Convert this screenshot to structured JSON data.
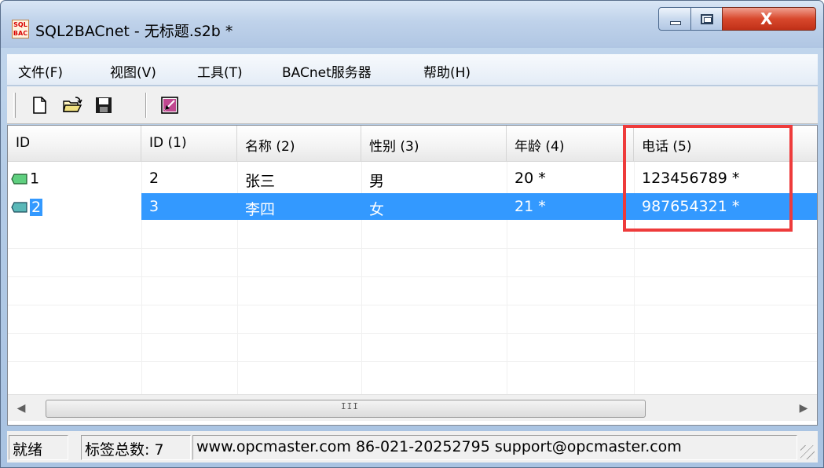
{
  "window": {
    "title": "SQL2BACnet - 无标题.s2b *",
    "icon_text_top": "SQL",
    "icon_text_bottom": "BAC",
    "close_glyph": "X"
  },
  "menu": [
    {
      "label": "文件(F)"
    },
    {
      "label": "视图(V)"
    },
    {
      "label": "工具(T)"
    },
    {
      "label": "BACnet服务器"
    },
    {
      "label": "帮助(H)"
    }
  ],
  "toolbar": {
    "icons": [
      "new-file-icon",
      "open-folder-icon",
      "save-disk-icon",
      "properties-icon"
    ]
  },
  "table": {
    "headers": [
      "ID",
      "ID (1)",
      "名称 (2)",
      "性别 (3)",
      "年龄 (4)",
      "电话 (5)"
    ],
    "rows": [
      {
        "id": "1",
        "c1": "2",
        "c2": "张三",
        "c3": "男",
        "c4": "20 *",
        "c5": "123456789 *",
        "selected": false
      },
      {
        "id": "2",
        "c1": "3",
        "c2": "李四",
        "c3": "女",
        "c4": "21 *",
        "c5": "987654321 *",
        "selected": true
      }
    ],
    "highlight_color": "#ee3b3b",
    "selection_color": "#3399ff"
  },
  "scrollbar": {
    "left_arrow": "◀",
    "right_arrow": "▶",
    "thumb_grip": "III"
  },
  "status": {
    "ready": "就绪",
    "tag_count": "标签总数: 7",
    "contact": "www.opcmaster.com 86-021-20252795 support@opcmaster.com"
  }
}
